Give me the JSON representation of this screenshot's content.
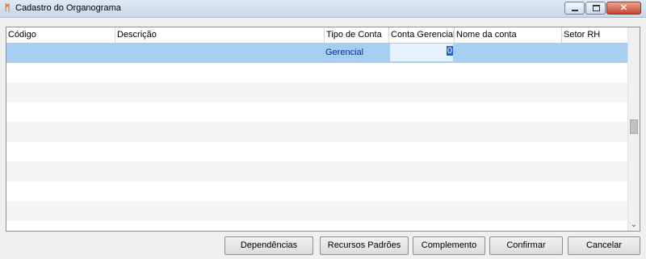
{
  "window": {
    "title": "Cadastro do Organograma",
    "app_icon": "app-logo-icon",
    "controls": [
      "minimize-icon",
      "maximize-icon",
      "close-icon"
    ]
  },
  "grid": {
    "columns": [
      "Código",
      "Descrição",
      "Tipo de Conta",
      "Conta Gerencial",
      "Nome da conta",
      "Setor RH"
    ],
    "selected_row": {
      "codigo": "",
      "descricao": "",
      "tipo_conta": "Gerencial",
      "conta_gerencial": "0",
      "nome_conta": "",
      "setor_rh": ""
    },
    "scroll_down_icon": "chevron-down-icon"
  },
  "buttons": {
    "dependencias": "Dependências",
    "recursos_padroes": "Recursos Padrões",
    "complemento": "Complemento",
    "confirmar": "Confirmar",
    "cancelar": "Cancelar"
  },
  "colors": {
    "selected_row": "#a7cdf0",
    "edit_highlight": "#1c63c4",
    "tipo_text": "#0a2a8a"
  }
}
